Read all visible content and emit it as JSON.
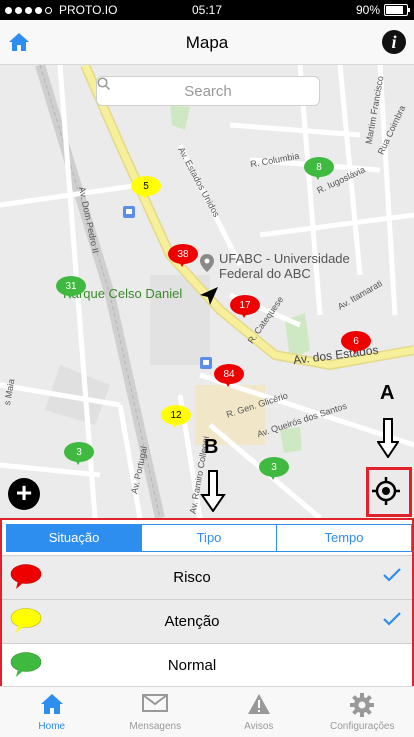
{
  "status_bar": {
    "carrier": "PROTO.IO",
    "time": "05:17",
    "battery": "90%"
  },
  "navbar": {
    "title": "Mapa"
  },
  "map": {
    "search_placeholder": "Search",
    "labels": {
      "ufabc": "UFABC - Universidade\nFederal do ABC",
      "park": "Parque Celso Daniel",
      "av_estados": "Av. dos Estados",
      "r_columbia": "R. Columbia",
      "r_iugoslavia": "R. Iugoslávia",
      "av_estados_unidos": "Av. Estados Unidos",
      "av_dom_pedro": "Av. Dom Pedro II",
      "r_catequese": "R. Catequese",
      "av_itamarati": "Av. Itamarati",
      "r_gen_glicerio": "R. Gen. Glicério",
      "av_queiros": "Av. Queirós dos Santos",
      "av_portugal": "Av. Portugal",
      "av_ramiro": "Av. Ramiro Colleoni",
      "r_martim": "Martim Francisco",
      "r_coimbra": "Rua Coimbra",
      "r_maia": "s Maia"
    },
    "markers": [
      {
        "value": "5",
        "color": "#ffff00"
      },
      {
        "value": "8",
        "color": "#3fb93f"
      },
      {
        "value": "38",
        "color": "#ee0000"
      },
      {
        "value": "31",
        "color": "#3fb93f"
      },
      {
        "value": "17",
        "color": "#ee0000"
      },
      {
        "value": "6",
        "color": "#ee0000"
      },
      {
        "value": "84",
        "color": "#ee0000"
      },
      {
        "value": "12",
        "color": "#ffff00"
      },
      {
        "value": "3",
        "color": "#3fb93f"
      },
      {
        "value": "3",
        "color": "#3fb93f"
      }
    ],
    "annotation_a": "A",
    "annotation_b": "B"
  },
  "filter_panel": {
    "tabs": [
      "Situação",
      "Tipo",
      "Tempo"
    ],
    "selected_tab": "Situação",
    "rows": [
      {
        "label": "Risco",
        "color": "#ee0000",
        "checked": true
      },
      {
        "label": "Atenção",
        "color": "#ffff00",
        "checked": true
      },
      {
        "label": "Normal",
        "color": "#3fb93f",
        "checked": false
      }
    ]
  },
  "tab_bar": {
    "items": [
      {
        "label": "Home",
        "icon": "home-icon",
        "active": true
      },
      {
        "label": "Mensagens",
        "icon": "envelope-icon",
        "active": false
      },
      {
        "label": "Avisos",
        "icon": "warning-icon",
        "active": false
      },
      {
        "label": "Configurações",
        "icon": "gear-icon",
        "active": false
      }
    ]
  },
  "colors": {
    "accent": "#2d8ef0",
    "highlight": "#e1222b",
    "risk": "#ee0000",
    "attention": "#ffff00",
    "normal": "#3fb93f"
  }
}
